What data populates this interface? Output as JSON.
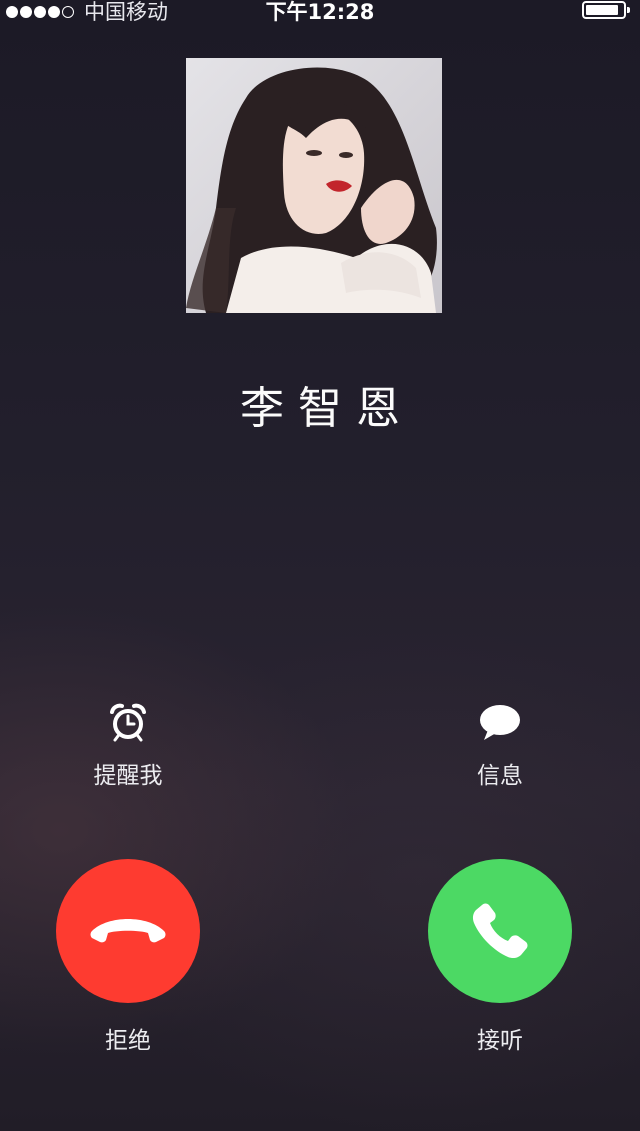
{
  "status_bar": {
    "signal_bars": 5,
    "signal_filled": 4,
    "carrier": "中国移动",
    "time": "下午12:28",
    "battery_level": 0.9
  },
  "caller": {
    "name": "李智恩"
  },
  "actions": {
    "remind_label": "提醒我",
    "message_label": "信息",
    "decline_label": "拒绝",
    "accept_label": "接听"
  },
  "icons": {
    "remind": "alarm-clock-icon",
    "message": "speech-bubble-icon",
    "decline": "phone-hangup-icon",
    "accept": "phone-icon"
  },
  "colors": {
    "decline": "#fe3b30",
    "accept": "#4cd964"
  }
}
